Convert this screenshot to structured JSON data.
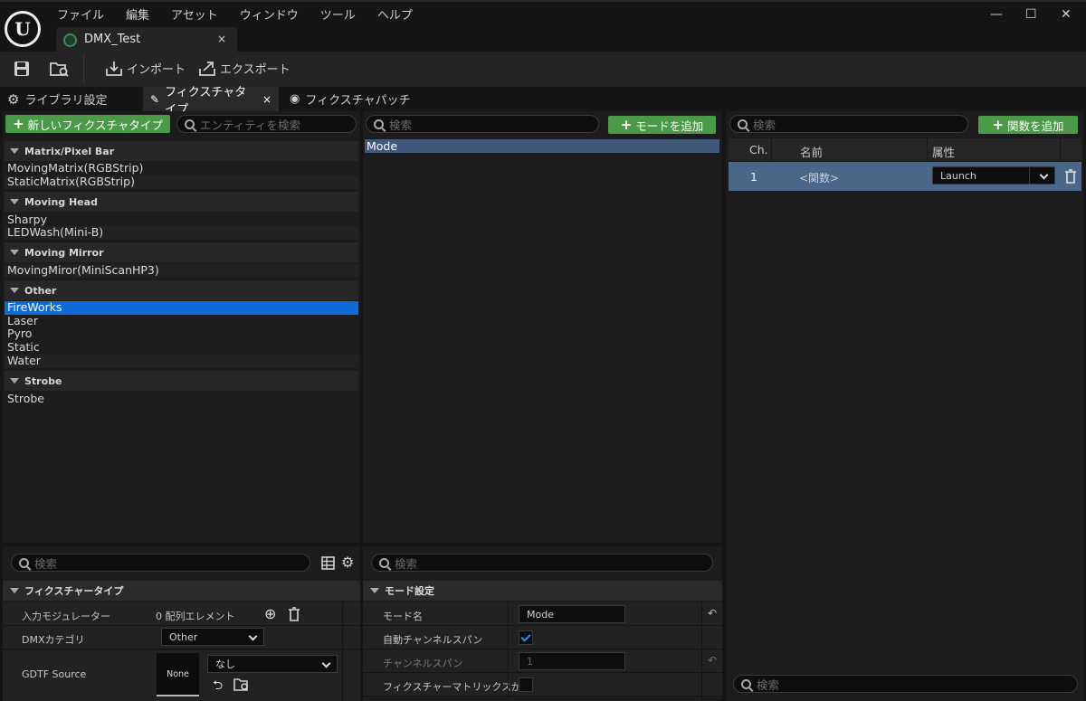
{
  "titlebar": {
    "menu": [
      "ファイル",
      "編集",
      "アセット",
      "ウィンドウ",
      "ツール",
      "ヘルプ"
    ],
    "document_tab": "DMX_Test",
    "close_glyph": "×",
    "window_controls": [
      "—",
      "☐",
      "✕"
    ]
  },
  "toolbar": {
    "import_label": "インポート",
    "export_label": "エクスポート"
  },
  "subtabs": {
    "library": "ライブラリ設定",
    "fixture_types": "フィクスチャタイプ",
    "fixture_patch": "フィクスチャパッチ"
  },
  "left_panel": {
    "new_button": "新しいフィクスチャタイプ",
    "search_placeholder": "エンティティを検索",
    "categories": [
      {
        "name": "Matrix/Pixel Bar",
        "items": [
          "MovingMatrix(RGBStrip)",
          "StaticMatrix(RGBStrip)"
        ]
      },
      {
        "name": "Moving Head",
        "items": [
          "Sharpy",
          "LEDWash(Mini-B)"
        ]
      },
      {
        "name": "Moving Mirror",
        "items": [
          "MovingMiror(MiniScanHP3)"
        ]
      },
      {
        "name": "Other",
        "items": [
          "FireWorks",
          "Laser",
          "Pyro",
          "Static",
          "Water"
        ]
      },
      {
        "name": "Strobe",
        "items": [
          "Strobe"
        ]
      }
    ],
    "selected_item": "FireWorks"
  },
  "middle_panel": {
    "search_placeholder": "検索",
    "add_mode_button": "モードを追加",
    "modes": [
      "Mode"
    ]
  },
  "right_panel": {
    "search_placeholder": "検索",
    "add_function_button": "関数を追加",
    "columns": [
      "Ch.",
      "名前",
      "属性"
    ],
    "rows": [
      {
        "ch": "1",
        "name": "<関数>",
        "attribute": "Launch"
      }
    ],
    "bottom_search_placeholder": "検索"
  },
  "details_left": {
    "search_placeholder": "検索",
    "section": "フィクスチャータイプ",
    "rows": {
      "input_modulator_label": "入力モジュレーター",
      "input_modulator_value": "0 配列エレメント",
      "dmx_category_label": "DMXカテゴリ",
      "dmx_category_value": "Other",
      "gdtf_label": "GDTF Source",
      "gdtf_thumb": "None",
      "gdtf_value": "なし"
    }
  },
  "details_mid": {
    "search_placeholder": "検索",
    "section": "モード設定",
    "rows": {
      "mode_name_label": "モード名",
      "mode_name_value": "Mode",
      "auto_span_label": "自動チャンネルスパン",
      "channel_span_label": "チャンネルスパン",
      "channel_span_value": "1",
      "matrix_label": "フィクスチャーマトリックスが..."
    }
  },
  "colors": {
    "accent_green": "#4a9a48",
    "selection_blue": "#0d6ad6",
    "check_blue": "#2f8df5"
  }
}
